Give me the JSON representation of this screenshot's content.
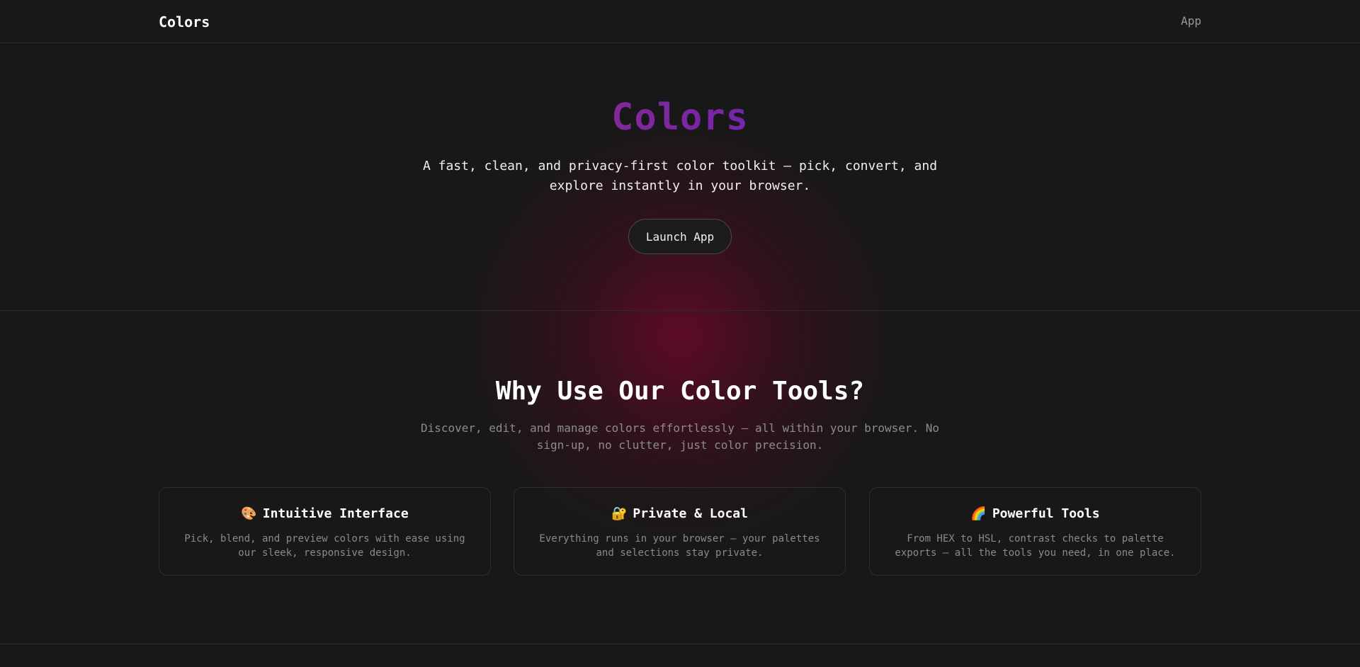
{
  "header": {
    "brand": "Colors",
    "nav_app": "App"
  },
  "hero": {
    "title": "Colors",
    "subtitle": "A fast, clean, and privacy-first color toolkit — pick, convert, and explore instantly in your browser.",
    "cta_label": "Launch App"
  },
  "features": {
    "title": "Why Use Our Color Tools?",
    "subtitle": "Discover, edit, and manage colors effortlessly — all within your browser. No sign-up, no clutter, just color precision.",
    "cards": [
      {
        "icon": "🎨",
        "icon_name": "palette-icon",
        "title": "Intuitive Interface",
        "description": "Pick, blend, and preview colors with ease using our sleek, responsive design."
      },
      {
        "icon": "🔐",
        "icon_name": "lock-icon",
        "title": "Private & Local",
        "description": "Everything runs in your browser — your palettes and selections stay private."
      },
      {
        "icon": "🌈",
        "icon_name": "rainbow-icon",
        "title": "Powerful Tools",
        "description": "From HEX to HSL, contrast checks to palette exports — all the tools you need, in one place."
      }
    ]
  },
  "colors": {
    "background": "#181818",
    "gradient_start": "#b5173c",
    "gradient_end": "#3740d0",
    "glow": "#960037"
  }
}
